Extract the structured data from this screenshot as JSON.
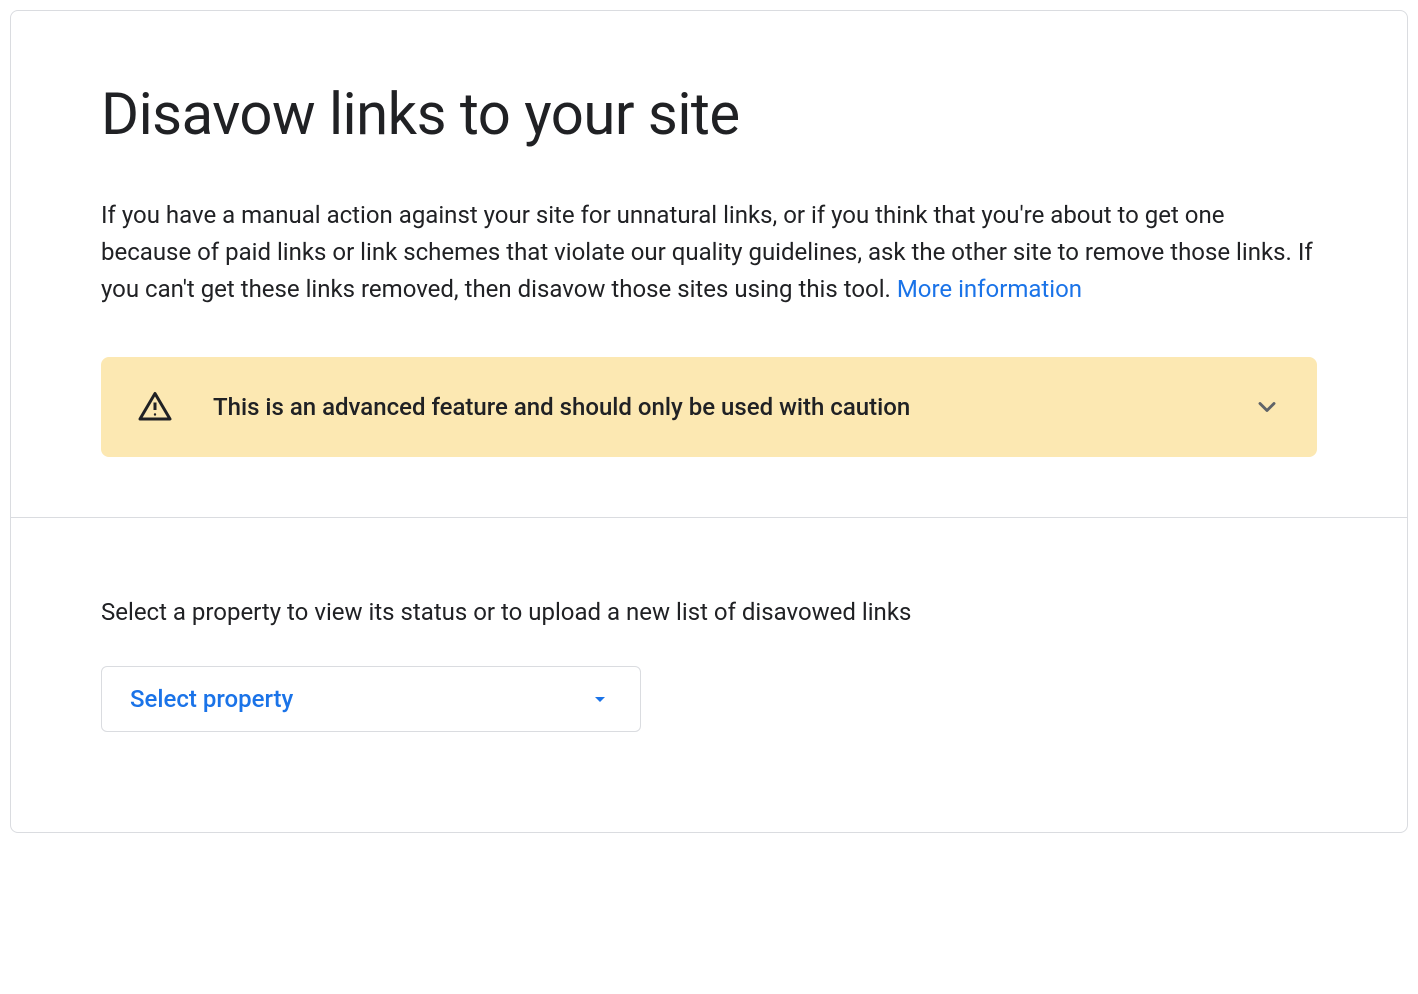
{
  "header": {
    "title": "Disavow links to your site",
    "description": "If you have a manual action against your site for unnatural links, or if you think that you're about to get one because of paid links or link schemes that violate our quality guidelines, ask the other site to remove those links. If you can't get these links removed, then disavow those sites using this tool. ",
    "more_info_label": "More information"
  },
  "warning": {
    "text": "This is an advanced feature and should only be used with caution"
  },
  "selector": {
    "label": "Select a property to view its status or to upload a new list of disavowed links",
    "dropdown_label": "Select property"
  }
}
